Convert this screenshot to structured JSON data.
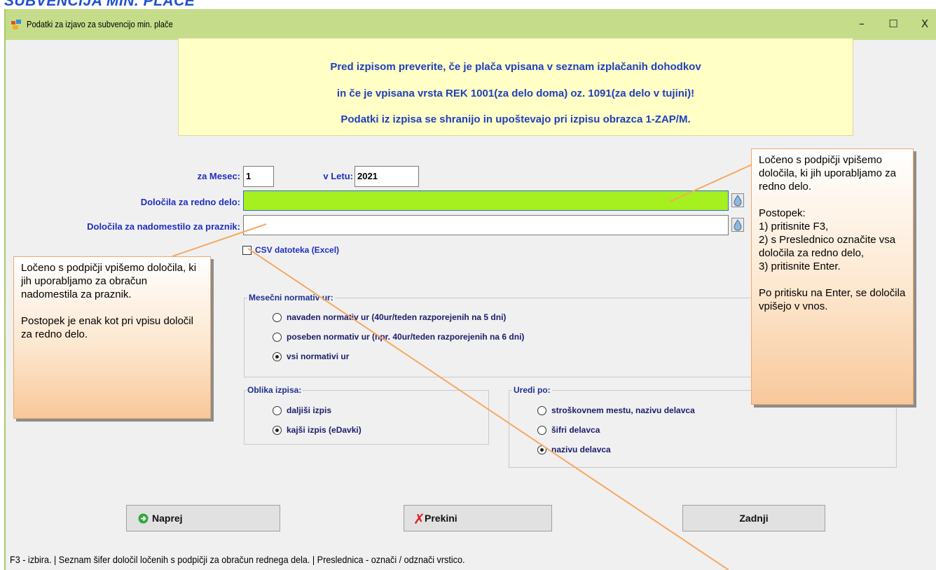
{
  "doc_heading": "SUBVENCIJA MIN. PLAČE",
  "window": {
    "title": "Podatki za izjavo za subvencijo min. plače",
    "minimize": "–",
    "maximize": "☐",
    "close": "X"
  },
  "info": {
    "line1": "Pred izpisom preverite, če je plača vpisana v seznam izplačanih dohodkov",
    "line2": "in če je vpisana vrsta REK 1001(za delo doma) oz. 1091(za delo v tujini)!",
    "line3": "Podatki iz izpisa se shranijo in upoštevajo pri izpisu obrazca 1-ZAP/M."
  },
  "form": {
    "month_label": "za Mesec:",
    "month_value": "1",
    "year_label": "v Letu:",
    "year_value": "2021",
    "regular_label": "Določila za redno delo:",
    "regular_value": "",
    "holiday_label": "Določila za nadomestilo za praznik:",
    "holiday_value": "",
    "csv_label": "CSV datoteka (Excel)"
  },
  "normativ": {
    "title": "Mesečni normativ ur:",
    "options": [
      "navaden normativ ur (40ur/teden razporejenih na 5 dni)",
      "poseben normativ ur (npr. 40ur/teden razporejenih na 6 dni)",
      "vsi normativi ur"
    ],
    "selected": 2
  },
  "oblika": {
    "title": "Oblika izpisa:",
    "options": [
      "daljiši izpis",
      "kajši izpis (eDavki)"
    ],
    "selected": 1
  },
  "uredi": {
    "title": "Uredi po:",
    "options": [
      "stroškovnem mestu, nazivu delavca",
      "šifri delavca",
      "nazivu delavca"
    ],
    "selected": 2
  },
  "buttons": {
    "next": "Naprej",
    "cancel": "Prekini",
    "last": "Zadnji"
  },
  "status": "F3 - izbira. | Seznam šifer določil ločenih s podpičji za obračun rednega dela. | Preslednica - označi / odznači vrstico.",
  "callouts": {
    "right": "Ločeno s podpičji vpišemo določila, ki jih uporabljamo za redno delo.\n\nPostopek:\n1) pritisnite F3,\n2) s Preslednico označite vsa določila za redno delo,\n3) pritisnite Enter.\n\nPo pritisku na Enter, se določila vpišejo v vnos.",
    "left": "Ločeno s podpičji vpišemo določila, ki jih uporabljamo za obračun nadomestila za praznik.\n\nPostopek je enak kot pri vpisu določil za redno delo."
  },
  "colors": {
    "titlebar": "#c5dd8a",
    "info_bg": "#ffffc6",
    "info_text": "#1f3fbf",
    "active_input": "#a6f020",
    "callout_border": "#f0a868"
  }
}
